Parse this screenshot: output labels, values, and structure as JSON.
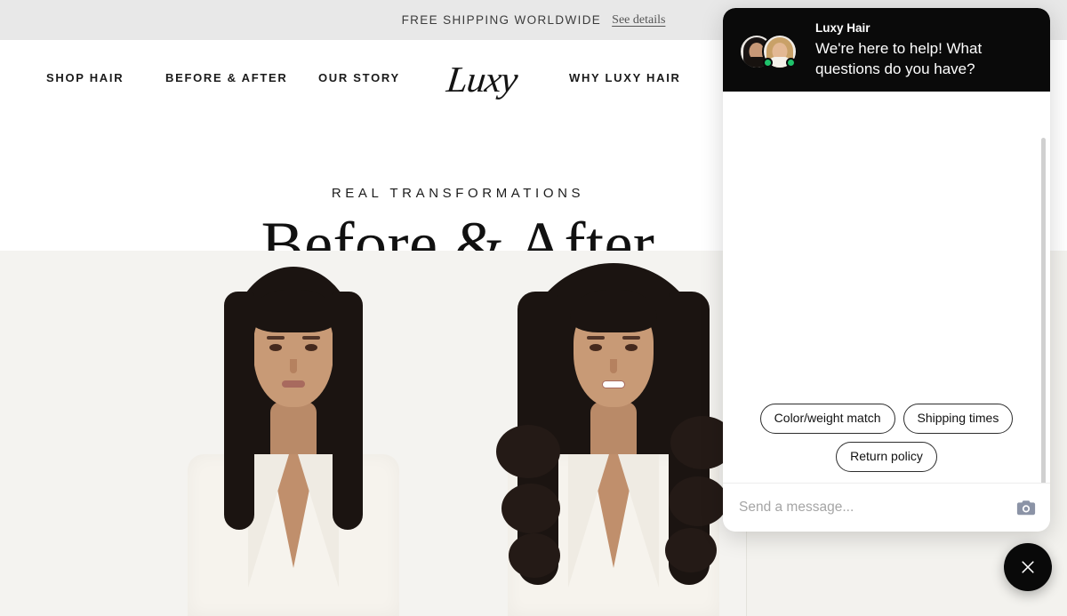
{
  "announcement": {
    "text": "FREE SHIPPING WORLDWIDE",
    "link_label": "See details"
  },
  "nav": {
    "logo_text": "Luxy",
    "items": [
      {
        "label": "SHOP HAIR"
      },
      {
        "label": "BEFORE & AFTER"
      },
      {
        "label": "OUR STORY"
      },
      {
        "label": "WHY LUXY HAIR"
      }
    ]
  },
  "hero": {
    "eyebrow": "REAL TRANSFORMATIONS",
    "title": "Before & After",
    "background_color": "#f2f2ee",
    "image_alt_before": "Model with straight shoulder-length dark hair in white blazer",
    "image_alt_after": "Model with long wavy dark hair extensions in white blazer"
  },
  "chat": {
    "brand_name": "Luxy Hair",
    "greeting": "We're here to help! What questions do you have?",
    "header_background": "#0a0a0a",
    "online_status_color": "#1fc26b",
    "quick_replies": [
      {
        "label": "Color/weight match"
      },
      {
        "label": "Shipping times"
      },
      {
        "label": "Return policy"
      }
    ],
    "input_placeholder": "Send a message...",
    "input_value": "",
    "camera_icon": "camera-icon",
    "launcher_icon": "close-icon"
  }
}
